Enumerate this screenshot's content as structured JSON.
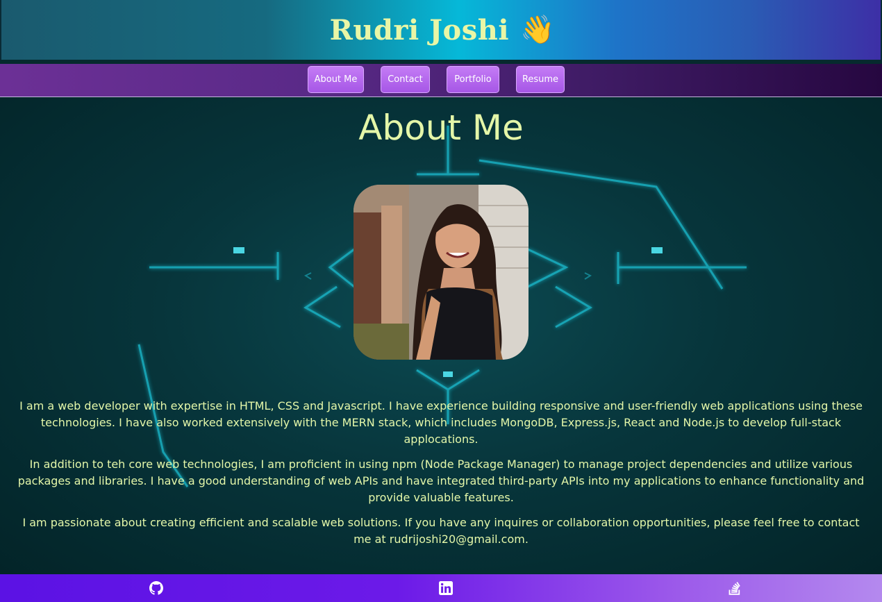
{
  "header": {
    "title": "Rudri Joshi",
    "emoji": "👋",
    "gradient": [
      "#1a5a6e",
      "#06b8d8",
      "#3d2fa6"
    ],
    "title_color": "#e9f6a6"
  },
  "nav": {
    "items": [
      {
        "label": "About Me"
      },
      {
        "label": "Contact"
      },
      {
        "label": "Portfolio"
      },
      {
        "label": "Resume"
      }
    ],
    "button_color": "#b56bf0"
  },
  "main": {
    "title": "About Me",
    "photo_icon": "profile-photo",
    "paragraphs": [
      "I am a web developer with expertise in HTML, CSS and Javascript. I have experience building responsive and user-friendly web applications using these technologies. I have also worked extensively with the MERN stack, which includes MongoDB, Express.js, React and Node.js to develop full-stack applocations.",
      "In addition to teh core web technologies, I am proficient in using npm (Node Package Manager) to manage project dependencies and utilize various packages and libraries. I have a good understanding of web APIs and have integrated third-party APIs into my applications to enhance functionality and provide valuable features.",
      "I am passionate about creating efficient and scalable web solutions. If you have any inquires or collaboration opportunities, please feel free to contact me at rudrijoshi20@gmail.com."
    ],
    "text_color": "#e4f7a9"
  },
  "footer": {
    "icons": [
      "github-icon",
      "linkedin-icon",
      "stackoverflow-icon"
    ],
    "gradient": [
      "#5b12e4",
      "#b489ee"
    ]
  }
}
